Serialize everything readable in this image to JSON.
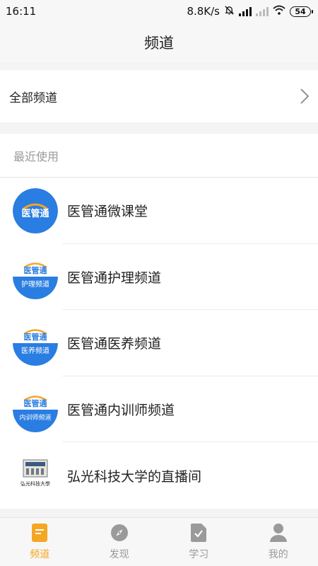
{
  "status_bar": {
    "time": "16:11",
    "net_speed": "8.8K/s",
    "battery": "54"
  },
  "header": {
    "title": "频道"
  },
  "all_channels": {
    "label": "全部频道"
  },
  "recent": {
    "header": "最近使用",
    "items": [
      {
        "label": "医管通微课堂",
        "logo_text": "医管通",
        "logo_sub": ""
      },
      {
        "label": "医管通护理频道",
        "logo_text": "医管通",
        "logo_sub": "护理频道"
      },
      {
        "label": "医管通医养频道",
        "logo_text": "医管通",
        "logo_sub": "医养频道"
      },
      {
        "label": "医管通内训师频道",
        "logo_text": "医管通",
        "logo_sub": "内训师频道"
      },
      {
        "label": "弘光科技大学的直播间",
        "logo_text": "弘光科技大學",
        "logo_sub": ""
      }
    ]
  },
  "bottom_nav": {
    "tabs": [
      {
        "label": "频道",
        "icon": "channel-icon",
        "active": true
      },
      {
        "label": "发现",
        "icon": "compass-icon",
        "active": false
      },
      {
        "label": "学习",
        "icon": "study-icon",
        "active": false
      },
      {
        "label": "我的",
        "icon": "profile-icon",
        "active": false
      }
    ]
  },
  "colors": {
    "accent": "#f5a623",
    "brand_blue": "#2a7de1",
    "inactive": "#9a9a9a"
  }
}
